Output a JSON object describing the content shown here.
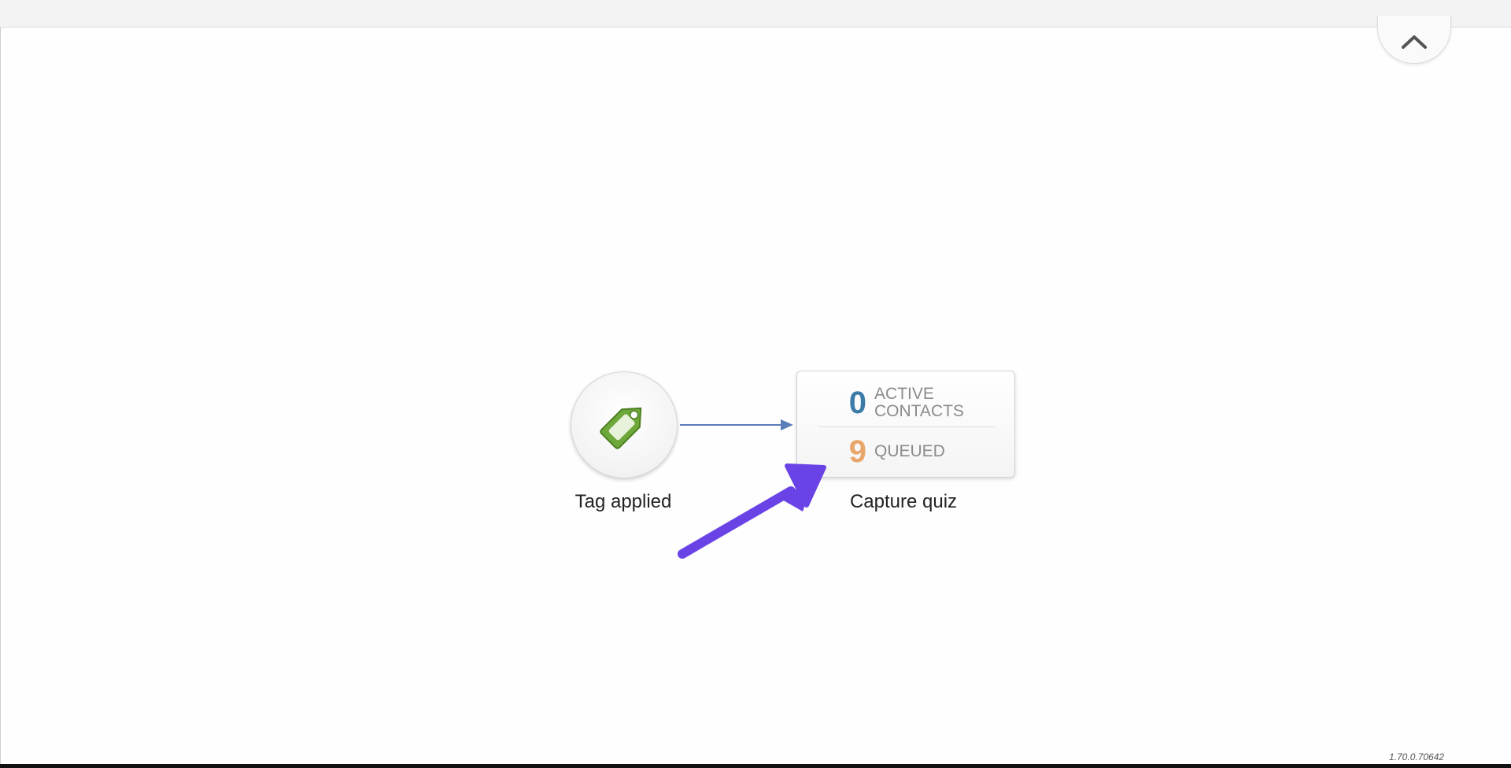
{
  "workflow": {
    "trigger": {
      "label": "Tag applied",
      "icon": "tag-icon",
      "icon_color": "#6ea83a"
    },
    "action": {
      "label": "Capture quiz",
      "active_count": "0",
      "active_label_line1": "ACTIVE",
      "active_label_line2": "CONTACTS",
      "queued_count": "9",
      "queued_label": "QUEUED",
      "active_color": "#3d7ca8",
      "queued_color": "#e8a66a"
    },
    "connector_color": "#5b7db8"
  },
  "annotation": {
    "arrow_color": "#6a43e6"
  },
  "footer": {
    "version": "1.70.0.70642"
  },
  "icons": {
    "collapse": "chevron-up-icon"
  }
}
